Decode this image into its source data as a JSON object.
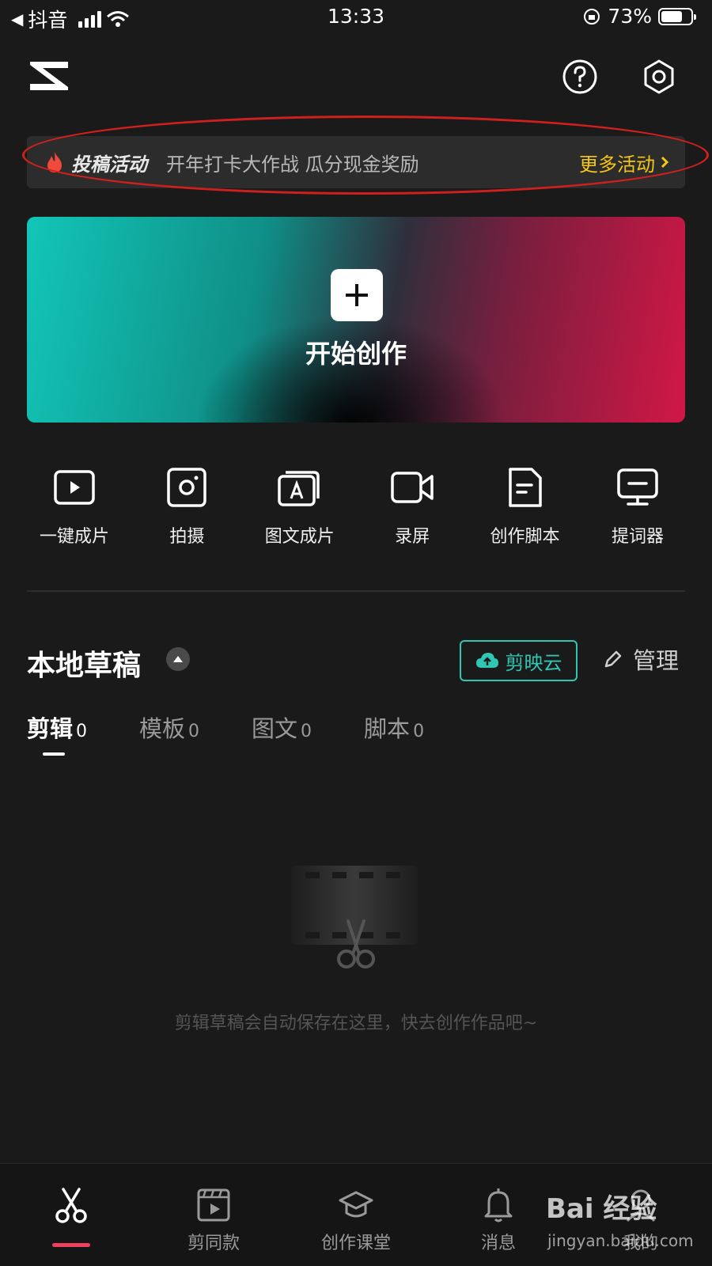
{
  "status_bar": {
    "back_app": "抖音",
    "time": "13:33",
    "battery": "73%",
    "battery_level": 0.73
  },
  "header": {
    "logo_icon": "capcut-logo-icon",
    "help_icon": "help-icon",
    "settings_icon": "settings-icon"
  },
  "banner": {
    "tag": "投稿活动",
    "description": "开年打卡大作战 瓜分现金奖励",
    "more_label": "更多活动",
    "more_color": "#f5c518"
  },
  "create": {
    "label": "开始创作"
  },
  "tools": [
    {
      "label": "一键成片",
      "icon": "one-click-video-icon"
    },
    {
      "label": "拍摄",
      "icon": "camera-icon"
    },
    {
      "label": "图文成片",
      "icon": "text-to-video-icon"
    },
    {
      "label": "录屏",
      "icon": "screen-record-icon"
    },
    {
      "label": "创作脚本",
      "icon": "script-icon"
    },
    {
      "label": "提词器",
      "icon": "teleprompter-icon"
    }
  ],
  "drafts": {
    "title": "本地草稿",
    "cloud_label": "剪映云",
    "manage_label": "管理",
    "tabs": [
      {
        "label": "剪辑",
        "count": "0"
      },
      {
        "label": "模板",
        "count": "0"
      },
      {
        "label": "图文",
        "count": "0"
      },
      {
        "label": "脚本",
        "count": "0"
      }
    ],
    "empty_text": "剪辑草稿会自动保存在这里，快去创作作品吧~"
  },
  "bottom_nav": [
    {
      "label": "",
      "icon": "scissors-icon"
    },
    {
      "label": "剪同款",
      "icon": "template-icon"
    },
    {
      "label": "创作课堂",
      "icon": "graduation-cap-icon"
    },
    {
      "label": "消息",
      "icon": "bell-icon"
    },
    {
      "label": "我的",
      "icon": "profile-icon"
    }
  ],
  "watermark": {
    "brand": "Bai 经验",
    "url": "jingyan.baidu.com"
  },
  "colors": {
    "accent_teal": "#2fc6b4",
    "accent_red": "#ef3f5f",
    "highlight_oval": "#d0201e"
  }
}
